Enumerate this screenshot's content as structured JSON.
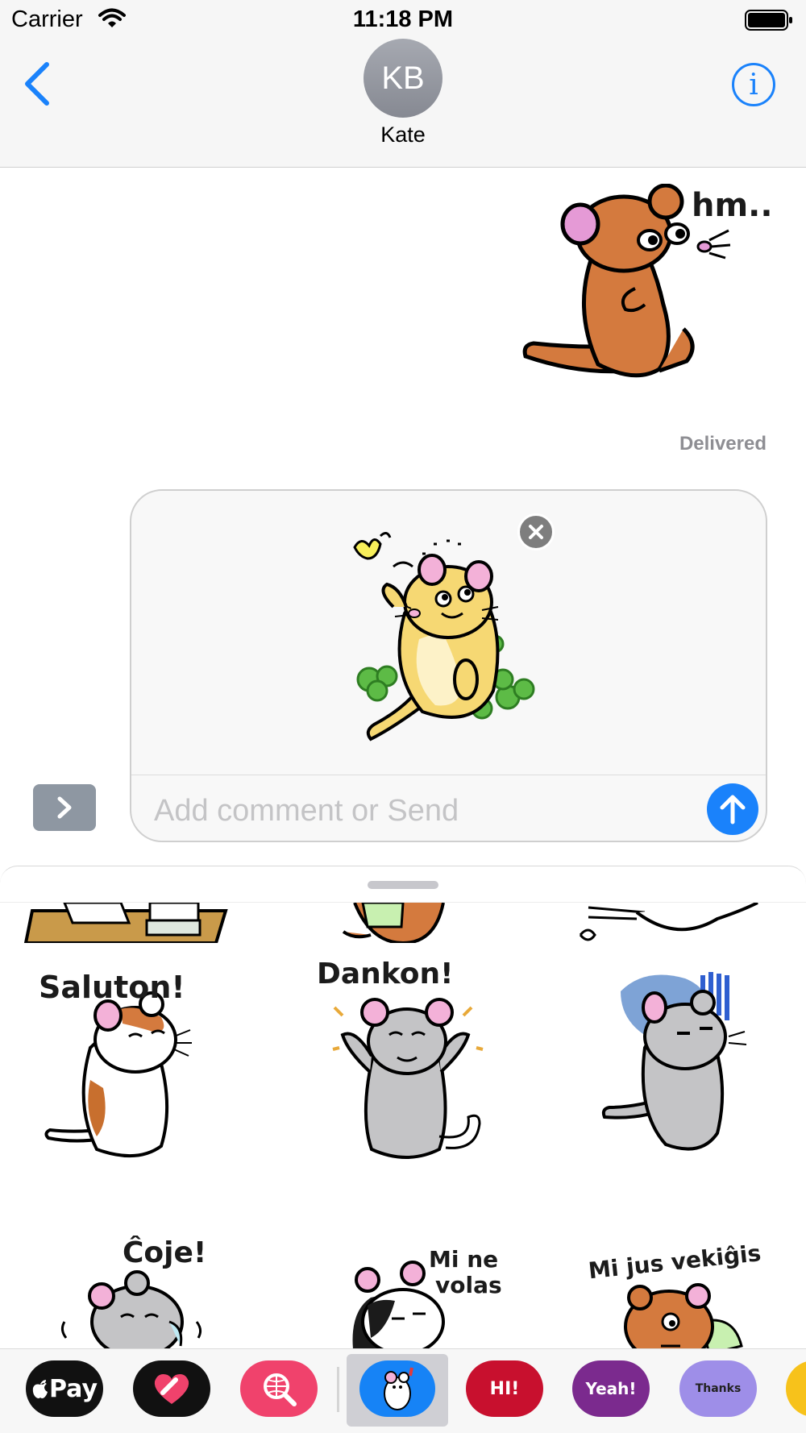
{
  "status_bar": {
    "carrier": "Carrier",
    "time": "11:18 PM"
  },
  "header": {
    "avatar_initials": "KB",
    "contact_name": "Kate"
  },
  "conversation": {
    "sent_sticker_caption": "hm...",
    "delivered_label": "Delivered"
  },
  "compose": {
    "placeholder": "Add comment or Send"
  },
  "stickers": [
    {
      "caption": ""
    },
    {
      "caption": ""
    },
    {
      "caption": ""
    },
    {
      "caption": "Saluton!"
    },
    {
      "caption": "Dankon!"
    },
    {
      "caption": ""
    },
    {
      "caption": "Ĉoje!"
    },
    {
      "caption_line1": "Mi ne",
      "caption_line2": "volas"
    },
    {
      "caption": "Mi jus vekiĝis"
    }
  ],
  "app_tray": {
    "apple_pay_label": "Pay",
    "hi_label": "HI!",
    "yeah_label": "Yeah!",
    "thanks_label": "Thanks"
  },
  "colors": {
    "accent_blue": "#1a82fb",
    "brown_rat": "#d47a3e",
    "yellow_rat": "#f6d873",
    "gray_rat": "#c4c4c6"
  }
}
